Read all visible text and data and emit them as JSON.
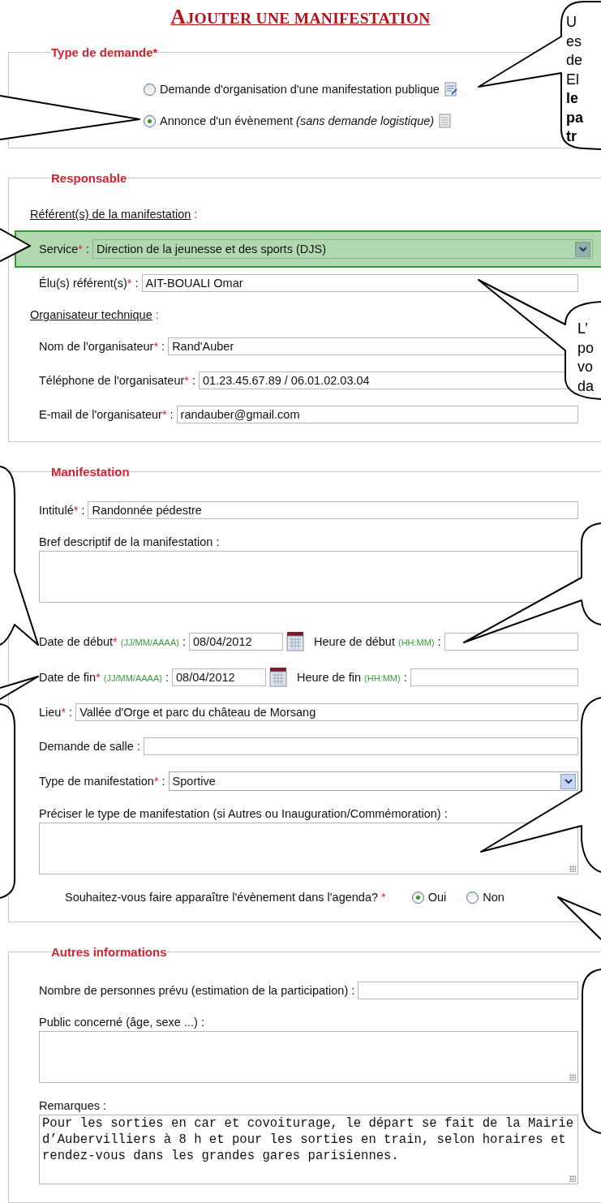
{
  "title": "AJOUTER UNE MANIFESTATION",
  "sections": [
    {
      "legend": "Type de demande",
      "mark": "*",
      "rows": [
        {
          "kind": "radio",
          "label": "Demande d'organisation d'une manifestation publique",
          "selected": false
        },
        {
          "kind": "radio",
          "label": "Annonce d'un évènement *(sans demande logistique)*",
          "selected": true
        }
      ]
    },
    {
      "legend": "Responsable",
      "rows": [
        {
          "kind": "subheading",
          "label": "Référent(s) de la manifestation",
          "sep": ":"
        },
        {
          "kind": "select",
          "label": "Service",
          "mark": "*",
          "sep": ":",
          "value": "Direction de la jeunesse et des sports (DJS)",
          "highlighted": true
        },
        {
          "kind": "text",
          "label": "Élu(s) référent(s)",
          "mark": "*",
          "sep": ":",
          "value": "AIT-BOUALI Omar"
        },
        {
          "kind": "subheading",
          "label": "Organisateur technique",
          "sep": ":"
        },
        {
          "kind": "text",
          "label": "Nom de l'organisateur",
          "mark": "*",
          "sep": ":",
          "value": "Rand'Auber"
        },
        {
          "kind": "text",
          "label": "Téléphone de l'organisateur",
          "mark": "*",
          "sep": ":",
          "value": "01.23.45.67.89 / 06.01.02.03.04"
        },
        {
          "kind": "text",
          "label": "E-mail de l'organisateur",
          "mark": "*",
          "sep": ":",
          "value": "randauber@gmail.com"
        }
      ]
    },
    {
      "legend": "Manifestation",
      "rows": [
        {
          "kind": "text",
          "label": "Intitulé",
          "mark": "*",
          "sep": ":",
          "value": "Randonnée pédestre"
        },
        {
          "kind": "textarea",
          "label": "Bref descriptif de la manifestation",
          "sep": ":"
        },
        {
          "kind": "dates",
          "items": [
            {
              "kind": "date",
              "label": "Date de début",
              "mark": "*",
              "hint": "(JJ/MM/AAAA)",
              "sep": ":",
              "value": "08/04/2012"
            },
            {
              "kind": "time",
              "label": "Heure de début",
              "hint": "(HH:MM)",
              "sep": ":"
            }
          ]
        },
        {
          "kind": "dates",
          "items": [
            {
              "kind": "date",
              "label": "Date de fin",
              "mark": "*",
              "hint": "(JJ/MM/AAAA)",
              "sep": ":",
              "value": "08/04/2012"
            },
            {
              "kind": "time",
              "label": "Heure de fin",
              "hint": "(HH:MM)",
              "sep": ":"
            }
          ]
        },
        {
          "kind": "text",
          "label": "Lieu",
          "mark": "*",
          "sep": ":",
          "value": "Vallée d'Orge et parc du château de Morsang"
        },
        {
          "kind": "text",
          "label": "Demande de salle",
          "sep": ":"
        },
        {
          "kind": "select",
          "label": "Type de manifestation",
          "mark": "*",
          "sep": ":",
          "value": "Sportive",
          "highlighted": false
        },
        {
          "kind": "textarea",
          "label": "Préciser le type de manifestation (si Autres ou Inauguration/Commémoration)",
          "sep": ":"
        },
        {
          "kind": "yesno",
          "question": "Souhaitez-vous faire apparaître l'évènement dans l'agenda?",
          "mark": "*",
          "options": [
            {
              "label": "Oui",
              "selected": true
            },
            {
              "label": "Non",
              "selected": false
            }
          ]
        }
      ]
    },
    {
      "legend": "Autres informations",
      "rows": [
        {
          "kind": "text",
          "label": "Nombre de personnes prévu (estimation de la participation)",
          "sep": ":"
        },
        {
          "kind": "textarea",
          "label": "Public concerné (âge, sexe ...)",
          "sep": ":"
        },
        {
          "kind": "textarea",
          "label": "Remarques",
          "sep": ":",
          "value": "Pour les sorties en car et covoiturage, le départ se fait de la Mairie d’Aubervilliers à 8 h et pour les sorties en train, selon horaires et rendez-vous dans les grandes gares parisiennes."
        }
      ]
    }
  ],
  "callouts": [
    {
      "lines": [
        {
          "text": "U",
          "bold": false
        },
        {
          "text": "es",
          "bold": false
        },
        {
          "text": "de",
          "bold": false
        },
        {
          "text": "El",
          "bold": false
        },
        {
          "text": "le",
          "bold": true
        },
        {
          "text": "pa",
          "bold": true
        },
        {
          "text": "tr",
          "bold": true
        }
      ]
    },
    {
      "lines": [
        {
          "text": "L’",
          "bold": false
        },
        {
          "text": "po",
          "bold": false
        },
        {
          "text": "vo",
          "bold": false
        },
        {
          "text": "da",
          "bold": false
        }
      ]
    }
  ]
}
